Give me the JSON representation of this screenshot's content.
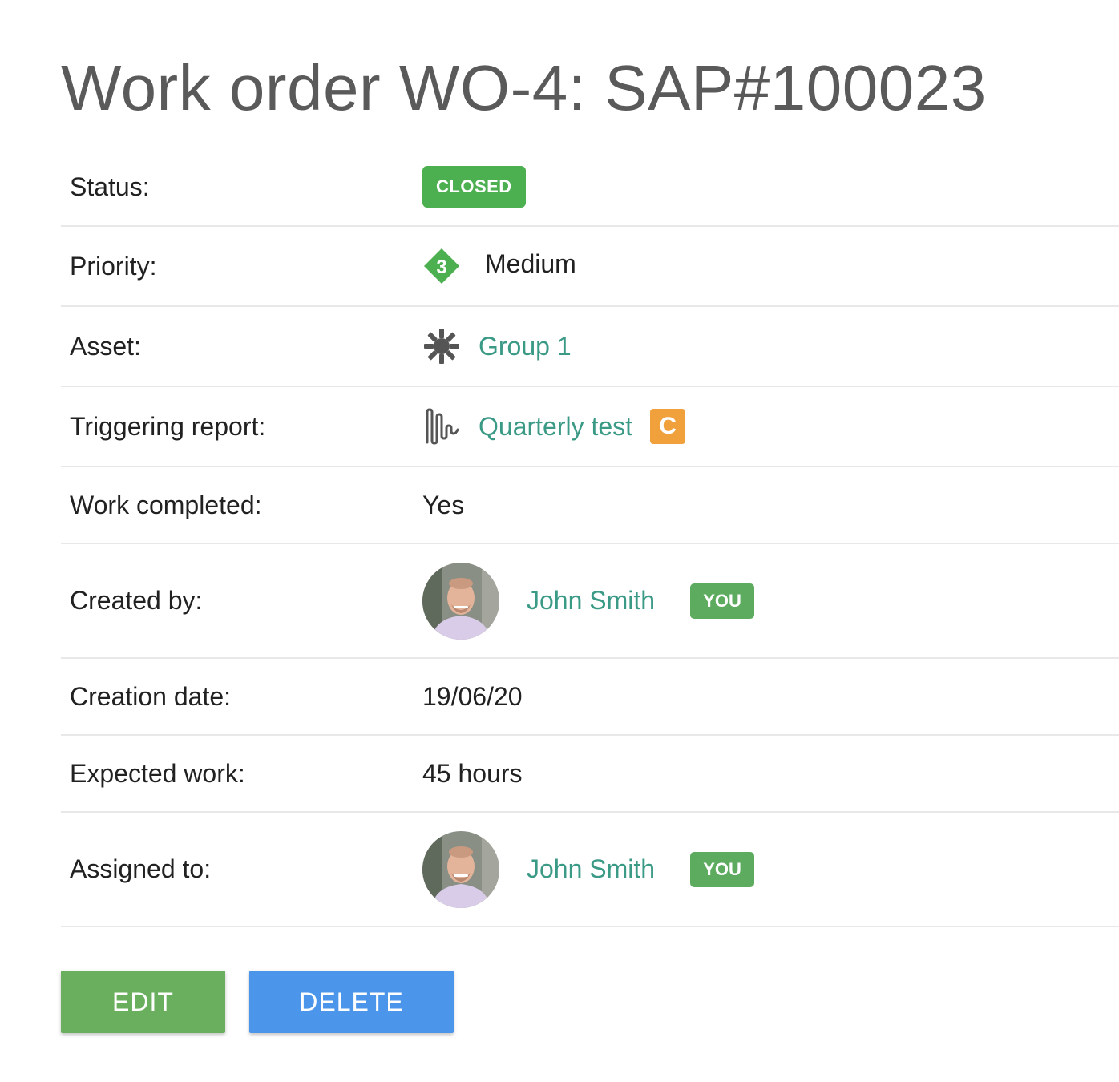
{
  "title": "Work order WO-4: SAP#100023",
  "colors": {
    "status_closed": "#4caf50",
    "you_badge": "#5cab5f",
    "link": "#3a9a86",
    "priority_icon": "#4caf50",
    "c_badge": "#f0a13c",
    "edit_button": "#69af5e",
    "delete_button": "#4b96ea"
  },
  "fields": {
    "status": {
      "label": "Status:",
      "value": "CLOSED"
    },
    "priority": {
      "label": "Priority:",
      "value": "Medium",
      "icon_number": "3",
      "icon": "priority-diamond-icon"
    },
    "asset": {
      "label": "Asset:",
      "value": "Group 1",
      "icon": "gear-icon"
    },
    "triggering_report": {
      "label": "Triggering report:",
      "value": "Quarterly test",
      "icon": "waveform-icon",
      "tag": "C"
    },
    "work_completed": {
      "label": "Work completed:",
      "value": "Yes"
    },
    "created_by": {
      "label": "Created by:",
      "name": "John Smith",
      "badge": "YOU"
    },
    "creation_date": {
      "label": "Creation date:",
      "value": "19/06/20"
    },
    "expected_work": {
      "label": "Expected work:",
      "value": "45 hours"
    },
    "assigned_to": {
      "label": "Assigned to:",
      "name": "John Smith",
      "badge": "YOU"
    }
  },
  "buttons": {
    "edit": "EDIT",
    "delete": "DELETE"
  }
}
